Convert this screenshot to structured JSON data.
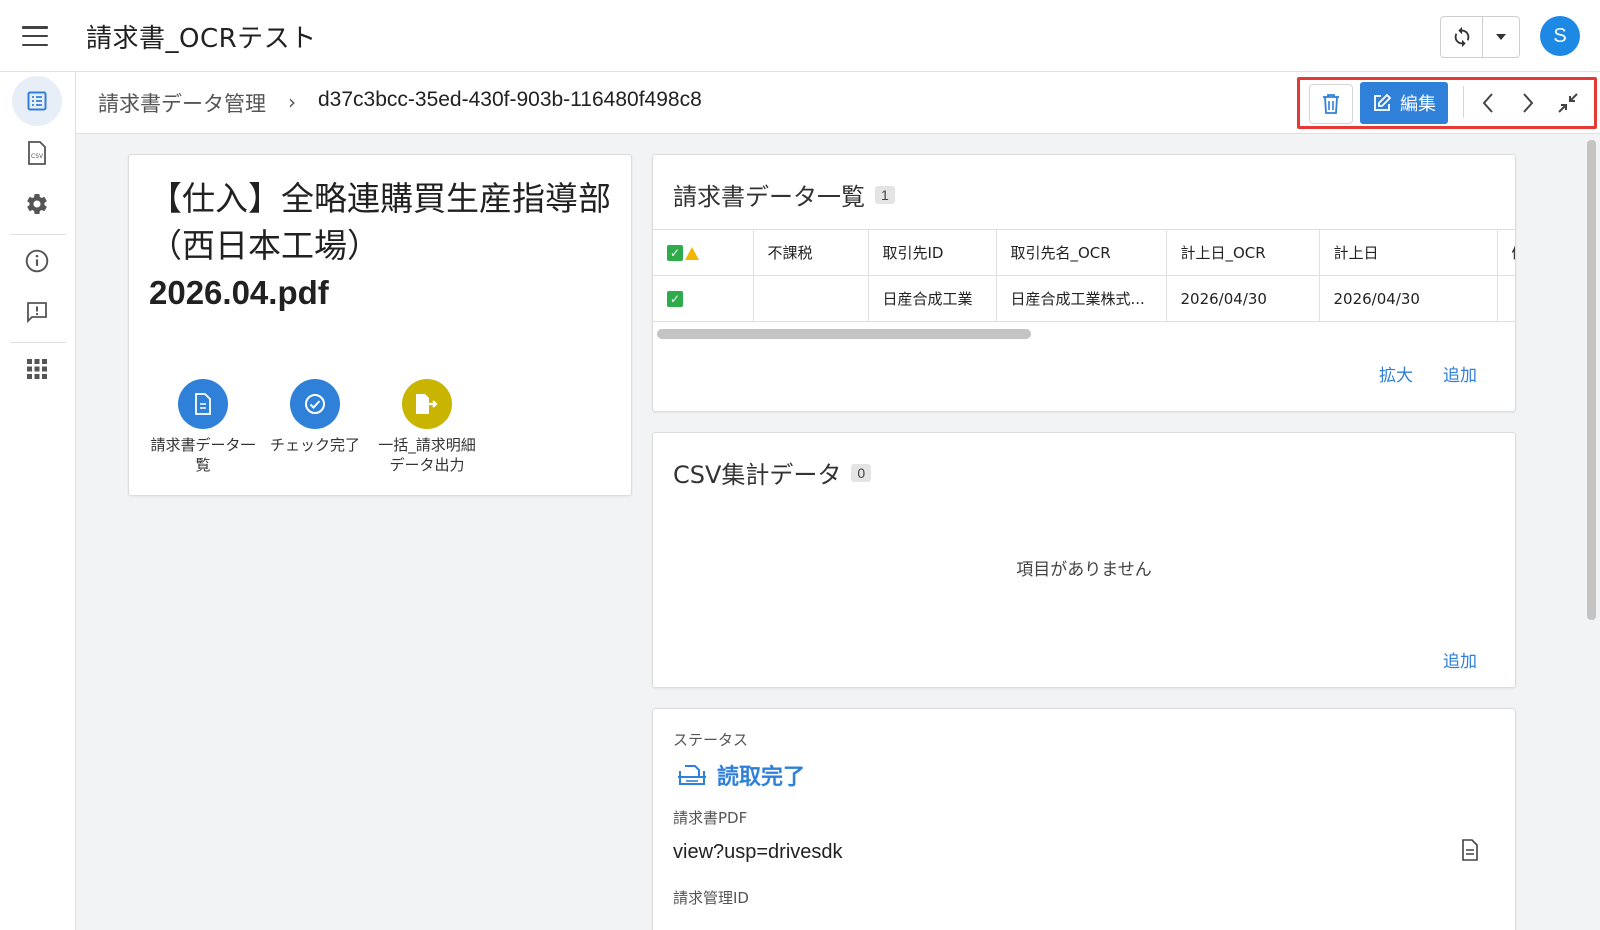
{
  "app": {
    "title": "請求書_OCRテスト",
    "avatar_letter": "S"
  },
  "rail": {
    "items": [
      "invoice-list-icon",
      "csv-file-icon",
      "gear-icon",
      "info-icon",
      "feedback-icon",
      "apps-grid-icon"
    ],
    "active": "invoice-list-icon"
  },
  "breadcrumb": {
    "root": "請求書データ管理",
    "separator": "›",
    "record_id": "d37c3bcc-35ed-430f-903b-116480f498c8"
  },
  "actions": {
    "edit_label": "編集",
    "highlight_color": "#e53935",
    "accent": "#2f80d8"
  },
  "document": {
    "title": "【仕入】全略連購買生産指導部（西日本工場）",
    "file_name": "2026.04.pdf",
    "quick_actions": [
      {
        "label": "請求書データ一覧",
        "icon": "document-icon",
        "color": "#2f80d8"
      },
      {
        "label": "チェック完了",
        "icon": "check-circle-icon",
        "color": "#2f80d8"
      },
      {
        "label": "一括_請求明細データ出力",
        "icon": "file-export-icon",
        "color": "#c9b400"
      }
    ]
  },
  "invoice_list": {
    "title": "請求書データ一覧",
    "count": "1",
    "columns": [
      "",
      "不課税",
      "取引先ID",
      "取引先名_OCR",
      "計上日_OCR",
      "計上日",
      "備"
    ],
    "rows": [
      {
        "check": "✓",
        "non_taxable": "",
        "vendor_id": "日産合成工業",
        "vendor_name_ocr": "日産合成工業株式...",
        "date_ocr": "2026/04/30",
        "date": "2026/04/30",
        "extra": ""
      }
    ],
    "expand_label": "拡大",
    "add_label": "追加"
  },
  "csv_summary": {
    "title": "CSV集計データ",
    "count": "0",
    "empty_text": "項目がありません",
    "add_label": "追加"
  },
  "details": {
    "status_label": "ステータス",
    "status_value": "読取完了",
    "pdf_label": "請求書PDF",
    "pdf_value": "view?usp=drivesdk",
    "manage_id_label": "請求管理ID"
  }
}
